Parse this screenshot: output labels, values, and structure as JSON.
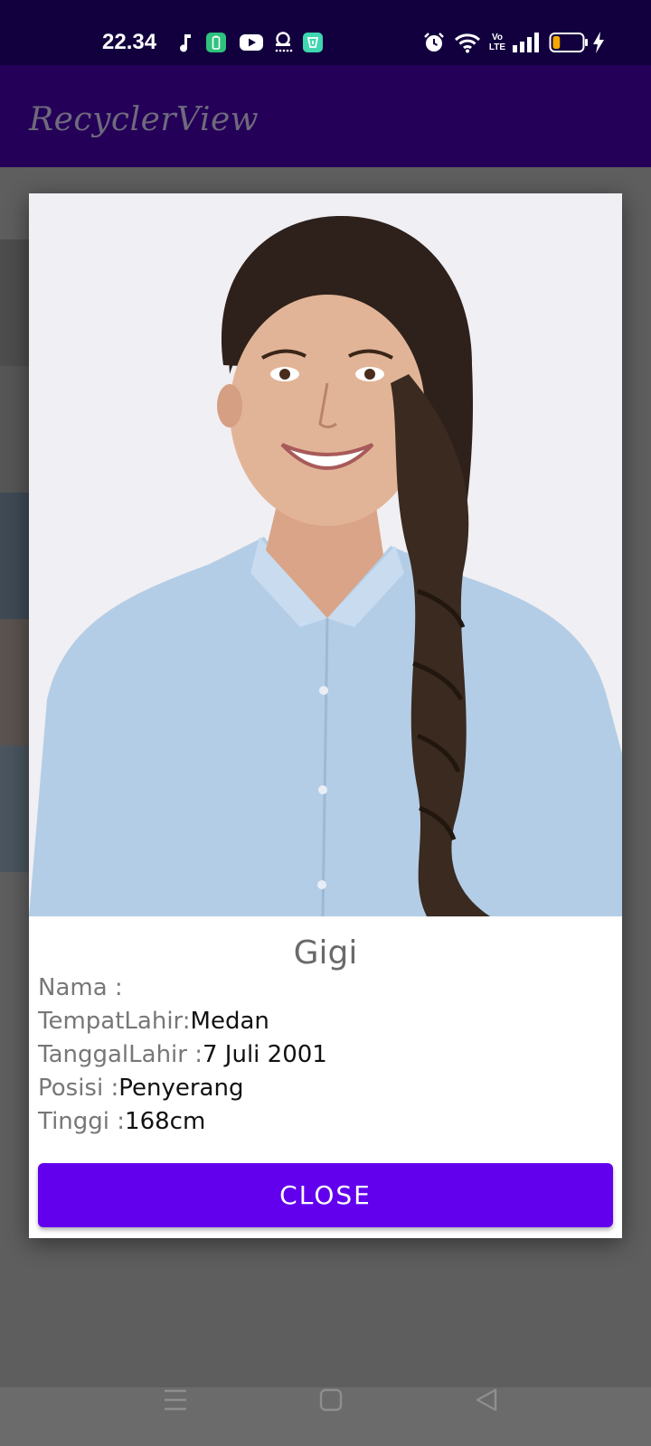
{
  "status_bar": {
    "time": "22.34",
    "icons": [
      "music-note-icon",
      "battery-saver-app-icon",
      "youtube-icon",
      "notification-icon",
      "app-icon",
      "alarm-icon",
      "wifi-icon",
      "volte-icon",
      "signal-icon",
      "battery-icon",
      "charging-icon"
    ],
    "battery_level": 0.25,
    "volte_top": "Vo",
    "volte_bottom": "LTE"
  },
  "app_bar": {
    "title": "RecyclerView"
  },
  "dialog": {
    "name": "Gigi",
    "details": [
      {
        "label": "Nama :",
        "value": ""
      },
      {
        "label": "TempatLahir:",
        "value": "Medan"
      },
      {
        "label": "TanggalLahir :",
        "value": "7 Juli 2001"
      },
      {
        "label": "Posisi :",
        "value": "Penyerang"
      },
      {
        "label": "Tinggi :",
        "value": "168cm"
      }
    ],
    "close_label": "CLOSE"
  },
  "colors": {
    "status_bar": "#12003e",
    "app_bar": "#240058",
    "button": "#6200ee",
    "scrim": "#6b6b6b"
  },
  "nav_bar": {
    "icons": [
      "menu-icon",
      "home-icon",
      "back-icon"
    ]
  }
}
